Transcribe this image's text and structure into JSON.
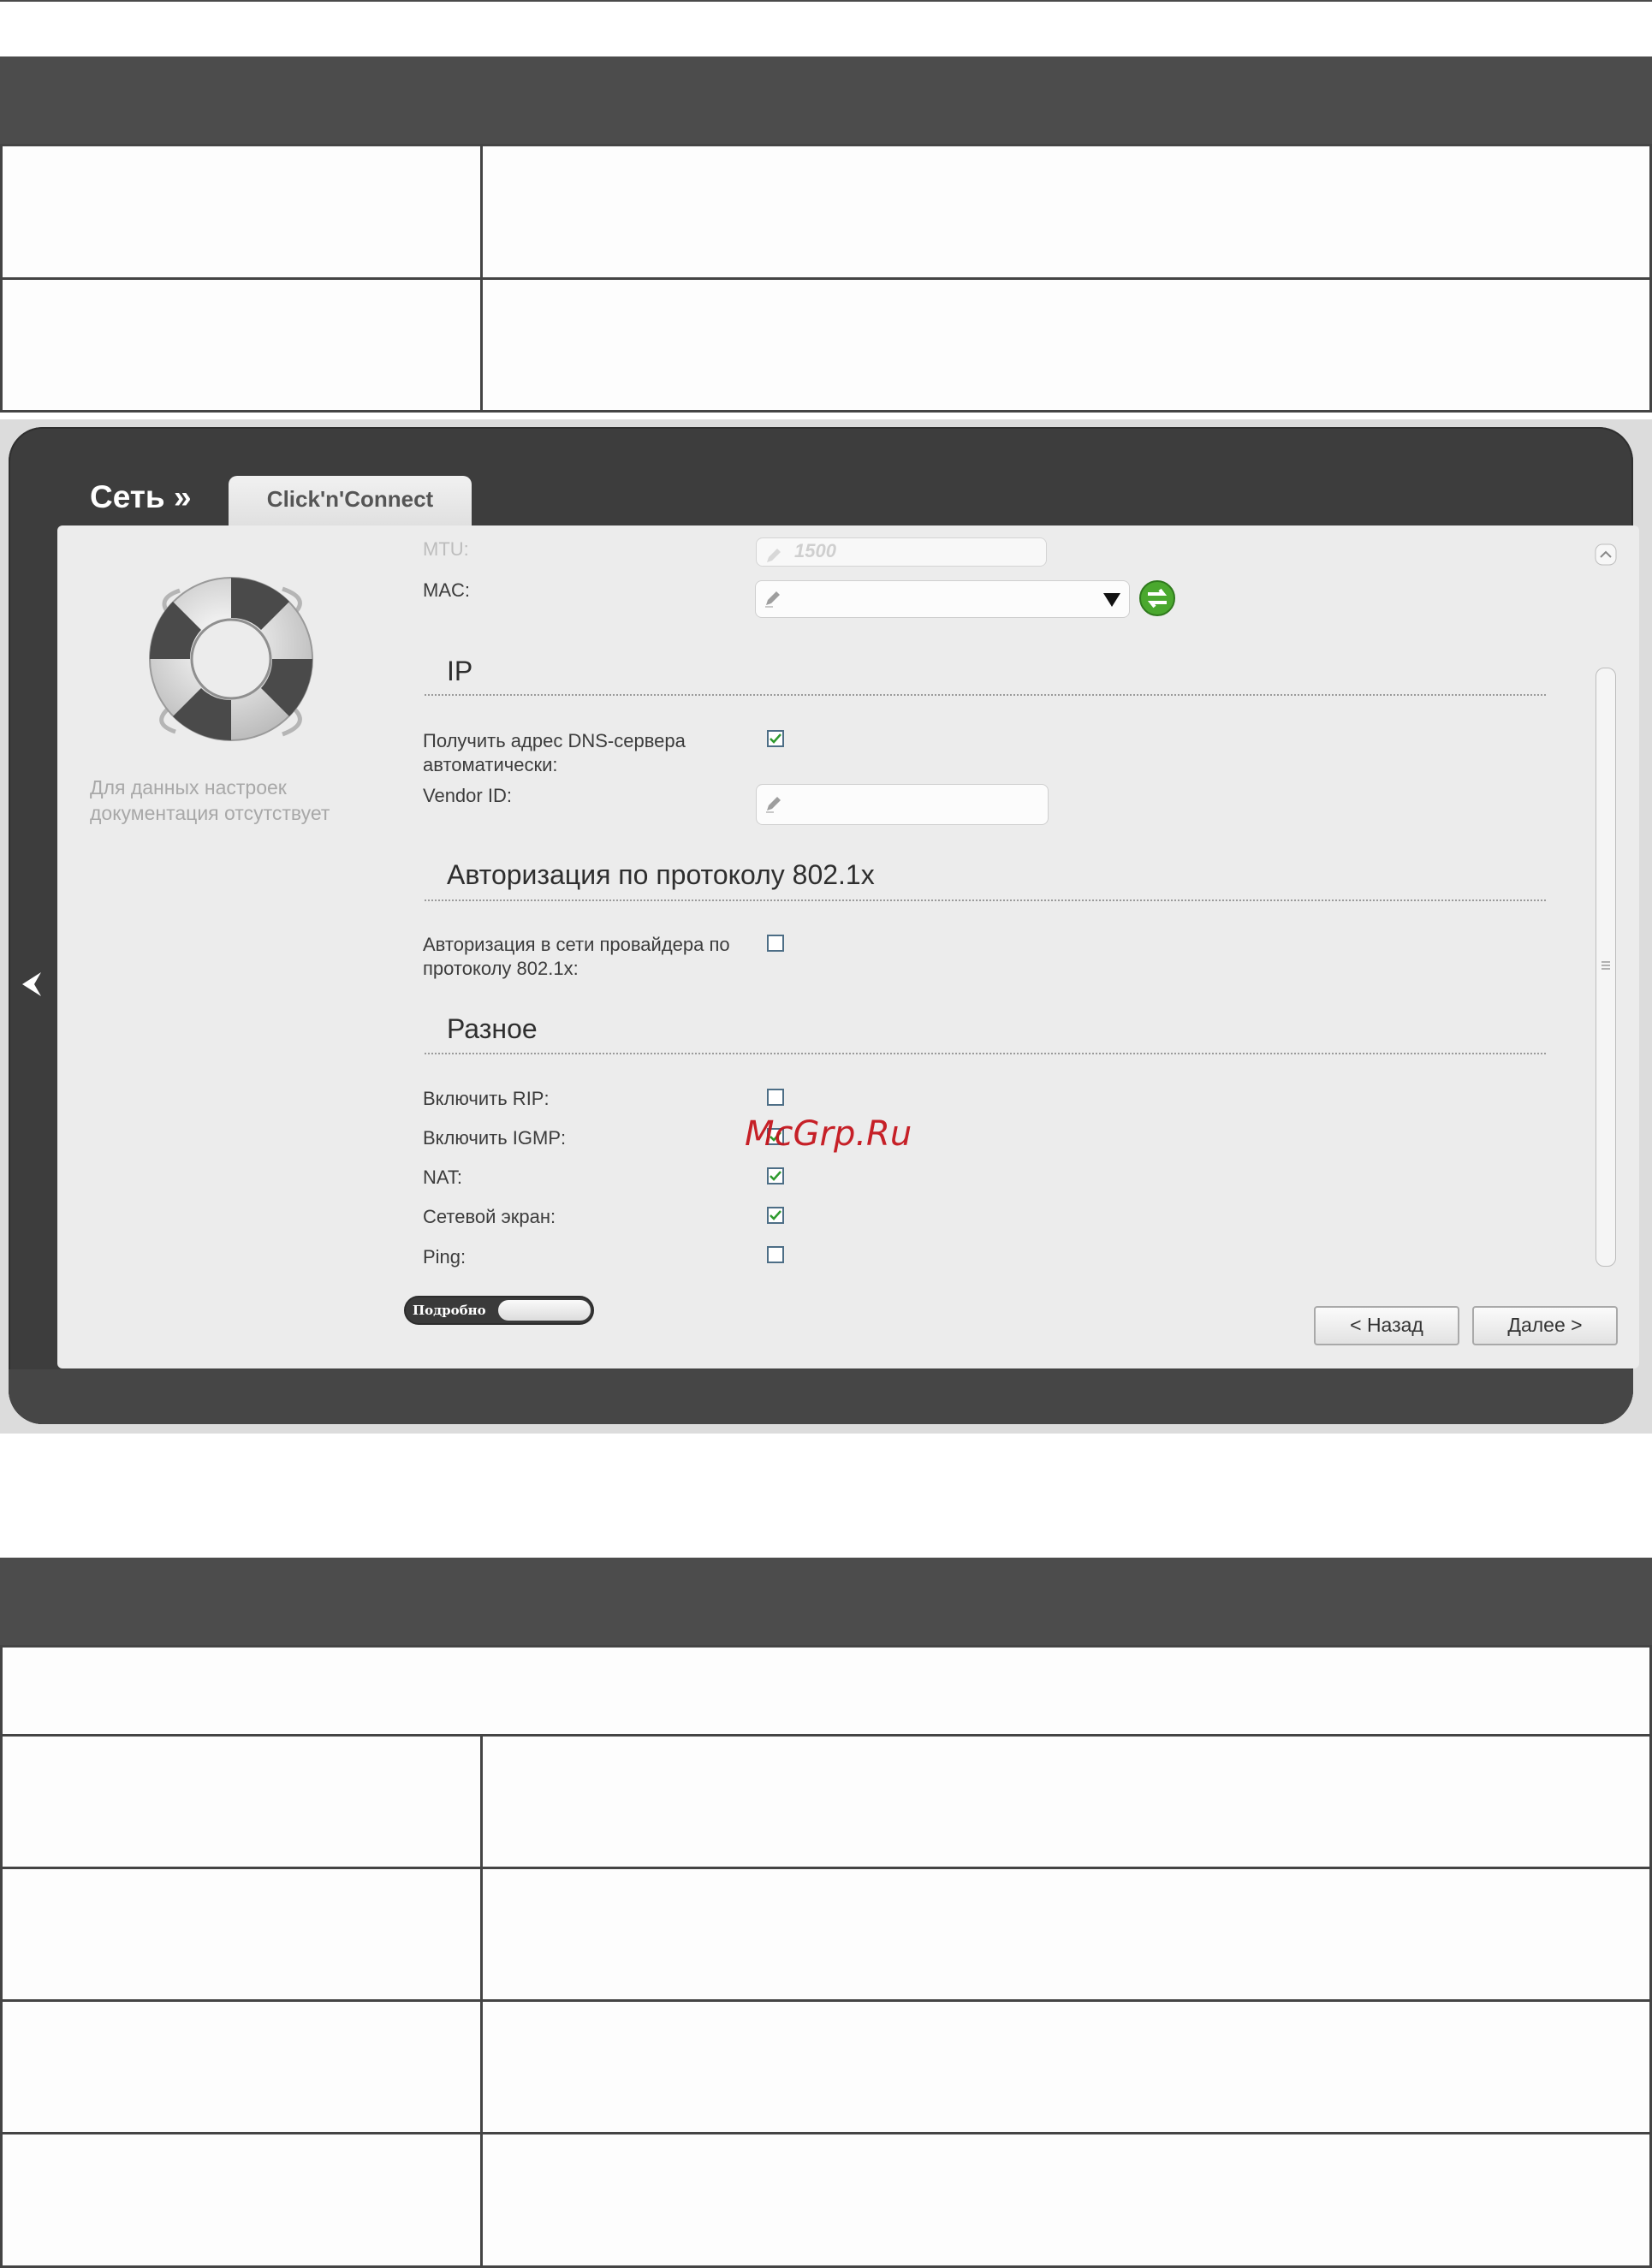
{
  "breadcrumb": "Сеть »",
  "tab": "Click'n'Connect",
  "help": {
    "text_line1": "Для данных настроек",
    "text_line2": "документация отсутствует"
  },
  "fields": {
    "mtu_label": "MTU:",
    "mtu_value": "1500",
    "mac_label": "MAC:",
    "mac_value": "",
    "vendor_id_label": "Vendor ID:",
    "vendor_id_value": ""
  },
  "sections": {
    "ip": "IP",
    "auth": "Авторизация по протоколу 802.1x",
    "misc": "Разное"
  },
  "ip": {
    "dns_auto_label_line1": "Получить адрес DNS-сервера",
    "dns_auto_label_line2": "автоматически:",
    "dns_auto_checked": true
  },
  "auth": {
    "label_line1": "Авторизация в сети провайдера по",
    "label_line2": "протоколу 802.1x:",
    "checked": false
  },
  "misc": {
    "rip_label": "Включить RIP:",
    "rip_checked": false,
    "igmp_label": "Включить IGMP:",
    "igmp_checked": true,
    "nat_label": "NAT:",
    "nat_checked": true,
    "firewall_label": "Сетевой экран:",
    "firewall_checked": true,
    "ping_label": "Ping:",
    "ping_checked": false
  },
  "toggle_label": "Подробно",
  "buttons": {
    "back": "< Назад",
    "next": "Далее >"
  },
  "watermark": "McGrp.Ru",
  "colors": {
    "dark_frame": "#3d3d3d",
    "panel": "#ececec",
    "check_green": "#2e9a2e",
    "watermark_red": "#c5161d"
  }
}
